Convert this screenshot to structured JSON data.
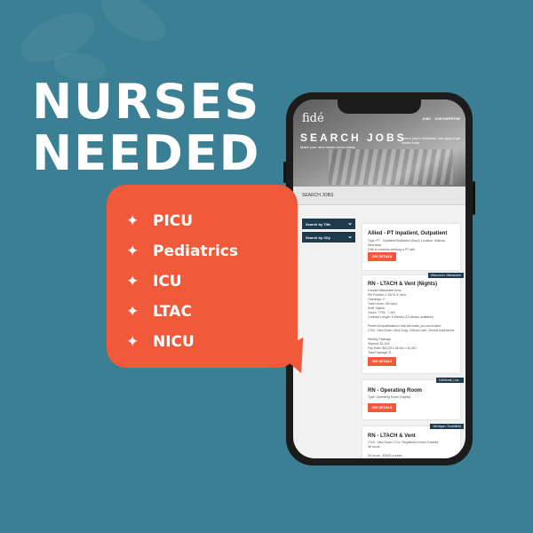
{
  "headline": {
    "line1": "NURSES",
    "line2": "NEEDED"
  },
  "specialties": [
    {
      "label": "PICU",
      "icon": "sparkle-icon"
    },
    {
      "label": "Pediatrics",
      "icon": "sparkle-icon"
    },
    {
      "label": "ICU",
      "icon": "sparkle-icon"
    },
    {
      "label": "LTAC",
      "icon": "sparkle-icon"
    },
    {
      "label": "NICU",
      "icon": "sparkle-icon"
    }
  ],
  "colors": {
    "background": "#3a7f93",
    "accent": "#f0593a",
    "navy": "#1e3a4d"
  },
  "phone": {
    "logo": "fidé",
    "nav": [
      "JOBS",
      "OUR EXPERTISE"
    ],
    "hero_title": "SEARCH JOBS",
    "hero_subtitle": "Make your next career move today",
    "hero_right": "Search jobs in healthcare, and apply to get started today",
    "search_bar_label": "SEARCH JOBS",
    "filters": [
      "Search by Title",
      "Search by City"
    ],
    "jobs": [
      {
        "title": "Allied - PT Inpatient, Outpatient",
        "tag": "",
        "details": "Type: PT - Inpatient/Outpatient (Days)   Location: Alliance, Nebraska\nFidé is currently seeking a PT with",
        "button": "SEE DETAILS"
      },
      {
        "title": "RN - LTACH & Vent (Nights)",
        "tag": "Wisconsin, Milwaukee",
        "details": "Greater Milwaukee Area\nRN Position: LTACH & Vent\nOpenings: 2\nTotal Hours: 36 hours\nShift: Nights\nHours: 7 PM - 7 AM\nContract Length: 8 Weeks (13 Weeks available)\n\nPreferred qualifications that will make you successful:\nLTAC, Step Down, Med-Surg, Critical Care, Clinical experience\n\nWeekly Package\nStipend: $1,344\nPay Rate: $41.25 x 36 hrs = $1,557\nTotal Package: $...",
        "button": "SEE DETAILS"
      },
      {
        "title": "RN - Operating Room",
        "tag": "California, Los...",
        "details": "Type: Operating Room (Nights)",
        "button": "SEE DETAILS"
      },
      {
        "title": "RN - LTACH & Vent",
        "tag": "Michigan, Southfield",
        "details": "LTAC, Step Down / ICU, Registered Nurse 8 weeks\n36 hours\n\n36 hours - $3400 a week",
        "button": ""
      }
    ]
  }
}
